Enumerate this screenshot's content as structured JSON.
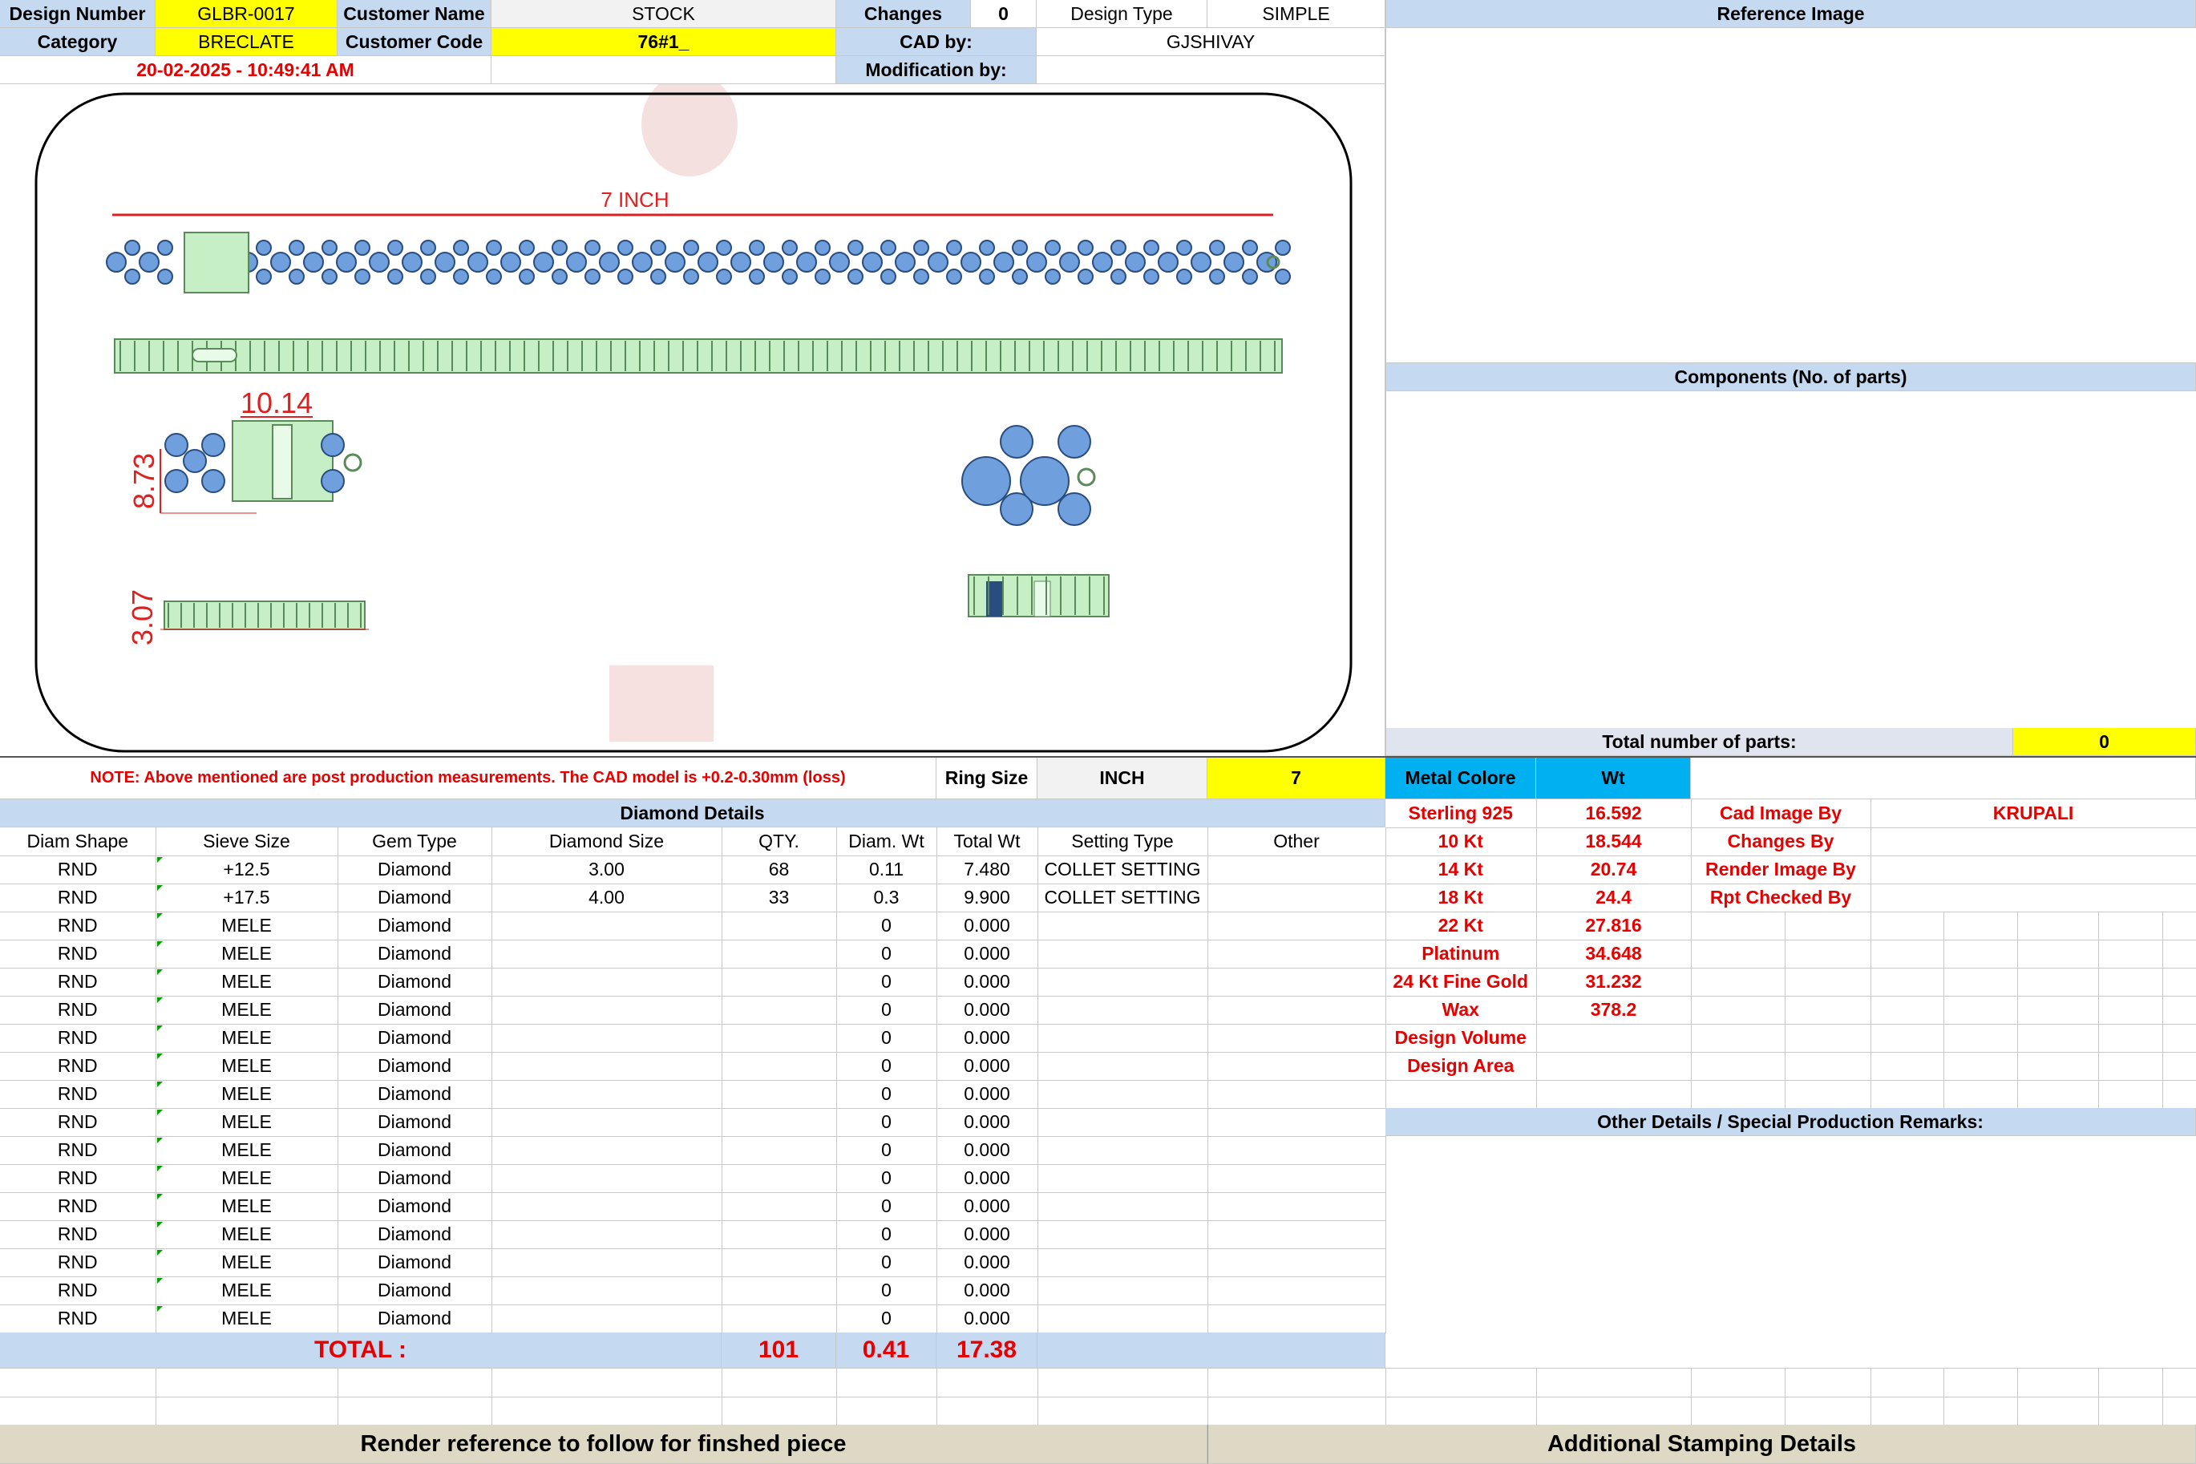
{
  "header": {
    "design_number_label": "Design Number",
    "design_number": "GLBR-0017",
    "customer_name_label": "Customer Name",
    "customer_name": "STOCK",
    "changes_label": "Changes",
    "changes": "0",
    "design_type_label": "Design Type",
    "design_type": "SIMPLE",
    "category_label": "Category",
    "category": "BRECLATE",
    "customer_code_label": "Customer Code",
    "customer_code": "76#1_",
    "cad_by_label": "CAD by:",
    "cad_by": "GJSHIVAY",
    "timestamp": "20-02-2025 - 10:49:41 AM",
    "modification_by_label": "Modification by:",
    "modification_by": ""
  },
  "drawing": {
    "length_label": "7 INCH",
    "dim_width": "10.14",
    "dim_height": "8.73",
    "dim_thickness": "3.07"
  },
  "right_panel": {
    "reference_image_label": "Reference Image",
    "components_label": "Components (No. of parts)",
    "total_parts_label": "Total number of parts:",
    "total_parts": "0"
  },
  "note": "NOTE: Above mentioned are post production measurements. The CAD model is +0.2-0.30mm (loss)",
  "ring_size": {
    "label": "Ring Size",
    "unit": "INCH",
    "value": "7"
  },
  "metal": {
    "color_label": "Metal Colore",
    "wt_label": "Wt",
    "rows": [
      {
        "name": "Sterling 925",
        "wt": "16.592"
      },
      {
        "name": "10 Kt",
        "wt": "18.544"
      },
      {
        "name": "14 Kt",
        "wt": "20.74"
      },
      {
        "name": "18 Kt",
        "wt": "24.4"
      },
      {
        "name": "22 Kt",
        "wt": "27.816"
      },
      {
        "name": "Platinum",
        "wt": "34.648"
      },
      {
        "name": "24 Kt Fine Gold",
        "wt": "31.232"
      },
      {
        "name": "Wax",
        "wt": "378.2"
      },
      {
        "name": "Design Volume",
        "wt": ""
      },
      {
        "name": "Design Area",
        "wt": ""
      }
    ]
  },
  "credits": [
    {
      "label": "Cad Image By",
      "value": "KRUPALI"
    },
    {
      "label": "Changes By",
      "value": ""
    },
    {
      "label": "Render Image By",
      "value": ""
    },
    {
      "label": "Rpt Checked By",
      "value": ""
    }
  ],
  "other_details_label": "Other Details / Special Production Remarks:",
  "diamond": {
    "title": "Diamond Details",
    "columns": [
      "Diam Shape",
      "Sieve Size",
      "Gem Type",
      "Diamond Size",
      "QTY.",
      "Diam. Wt",
      "Total Wt",
      "Setting Type",
      "Other"
    ],
    "rows": [
      [
        "RND",
        "+12.5",
        "Diamond",
        "3.00",
        "68",
        "0.11",
        "7.480",
        "COLLET SETTING",
        ""
      ],
      [
        "RND",
        "+17.5",
        "Diamond",
        "4.00",
        "33",
        "0.3",
        "9.900",
        "COLLET SETTING",
        ""
      ],
      [
        "RND",
        "MELE",
        "Diamond",
        "",
        "",
        "0",
        "0.000",
        "",
        ""
      ],
      [
        "RND",
        "MELE",
        "Diamond",
        "",
        "",
        "0",
        "0.000",
        "",
        ""
      ],
      [
        "RND",
        "MELE",
        "Diamond",
        "",
        "",
        "0",
        "0.000",
        "",
        ""
      ],
      [
        "RND",
        "MELE",
        "Diamond",
        "",
        "",
        "0",
        "0.000",
        "",
        ""
      ],
      [
        "RND",
        "MELE",
        "Diamond",
        "",
        "",
        "0",
        "0.000",
        "",
        ""
      ],
      [
        "RND",
        "MELE",
        "Diamond",
        "",
        "",
        "0",
        "0.000",
        "",
        ""
      ],
      [
        "RND",
        "MELE",
        "Diamond",
        "",
        "",
        "0",
        "0.000",
        "",
        ""
      ],
      [
        "RND",
        "MELE",
        "Diamond",
        "",
        "",
        "0",
        "0.000",
        "",
        ""
      ],
      [
        "RND",
        "MELE",
        "Diamond",
        "",
        "",
        "0",
        "0.000",
        "",
        ""
      ],
      [
        "RND",
        "MELE",
        "Diamond",
        "",
        "",
        "0",
        "0.000",
        "",
        ""
      ],
      [
        "RND",
        "MELE",
        "Diamond",
        "",
        "",
        "0",
        "0.000",
        "",
        ""
      ],
      [
        "RND",
        "MELE",
        "Diamond",
        "",
        "",
        "0",
        "0.000",
        "",
        ""
      ],
      [
        "RND",
        "MELE",
        "Diamond",
        "",
        "",
        "0",
        "0.000",
        "",
        ""
      ],
      [
        "RND",
        "MELE",
        "Diamond",
        "",
        "",
        "0",
        "0.000",
        "",
        ""
      ],
      [
        "RND",
        "MELE",
        "Diamond",
        "",
        "",
        "0",
        "0.000",
        "",
        ""
      ]
    ],
    "total_label": "TOTAL :",
    "total_qty": "101",
    "total_diam_wt": "0.41",
    "total_wt": "17.38"
  },
  "footer": {
    "render_reference": "Render reference to follow for finshed piece",
    "stamping": "Additional Stamping Details"
  },
  "colors": {
    "header_blue": "#c5d9f1",
    "highlight_yellow": "#ffff00",
    "metal_cyan": "#00b0f0",
    "text_red": "#e60000",
    "footer_tan": "#ddd9c4",
    "diamond_blue": "#6f9fdc",
    "metal_green": "#c6efc6"
  }
}
